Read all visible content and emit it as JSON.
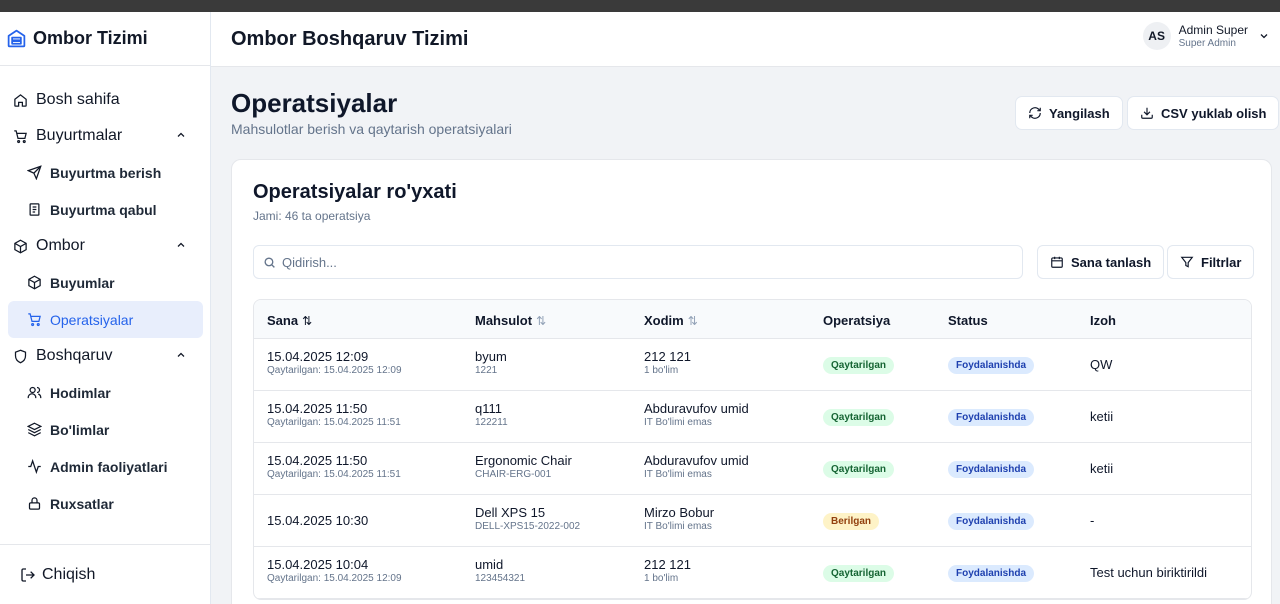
{
  "sidebar": {
    "brand": "Ombor Tizimi",
    "items": [
      {
        "label": "Bosh sahifa"
      },
      {
        "label": "Buyurtmalar"
      },
      {
        "label": "Buyurtma berish"
      },
      {
        "label": "Buyurtma qabul"
      },
      {
        "label": "Ombor"
      },
      {
        "label": "Buyumlar"
      },
      {
        "label": "Operatsiyalar"
      },
      {
        "label": "Boshqaruv"
      },
      {
        "label": "Hodimlar"
      },
      {
        "label": "Bo'limlar"
      },
      {
        "label": "Admin faoliyatlari"
      },
      {
        "label": "Ruxsatlar"
      }
    ],
    "logout": "Chiqish"
  },
  "header": {
    "title": "Ombor Boshqaruv Tizimi",
    "user": {
      "initials": "AS",
      "name": "Admin Super",
      "role": "Super Admin"
    }
  },
  "page": {
    "title": "Operatsiyalar",
    "subtitle": "Mahsulotlar berish va qaytarish operatsiyalari",
    "refresh_label": "Yangilash",
    "csv_label": "CSV yuklab olish"
  },
  "card": {
    "title": "Operatsiyalar ro'yxati",
    "subtitle": "Jami: 46 ta operatsiya",
    "search_placeholder": "Qidirish...",
    "date_button": "Sana tanlash",
    "filter_button": "Filtrlar"
  },
  "table": {
    "columns": [
      "Sana",
      "Mahsulot",
      "Xodim",
      "Operatsiya",
      "Status",
      "Izoh"
    ],
    "rows": [
      {
        "date": "15.04.2025 12:09",
        "date_sub": "Qaytarilgan: 15.04.2025 12:09",
        "product": "byum",
        "product_sub": "1221",
        "employee": "212 121",
        "employee_sub": "1 bo'lim",
        "operation": "Qaytarilgan",
        "status": "Foydalanishda",
        "note": "QW"
      },
      {
        "date": "15.04.2025 11:50",
        "date_sub": "Qaytarilgan: 15.04.2025 11:51",
        "product": "q111",
        "product_sub": "122211",
        "employee": "Abduravufov umid",
        "employee_sub": "IT Bo'limi emas",
        "operation": "Qaytarilgan",
        "status": "Foydalanishda",
        "note": "ketii"
      },
      {
        "date": "15.04.2025 11:50",
        "date_sub": "Qaytarilgan: 15.04.2025 11:51",
        "product": "Ergonomic Chair",
        "product_sub": "CHAIR-ERG-001",
        "employee": "Abduravufov umid",
        "employee_sub": "IT Bo'limi emas",
        "operation": "Qaytarilgan",
        "status": "Foydalanishda",
        "note": "ketii"
      },
      {
        "date": "15.04.2025 10:30",
        "date_sub": "",
        "product": "Dell XPS 15",
        "product_sub": "DELL-XPS15-2022-002",
        "employee": "Mirzo Bobur",
        "employee_sub": "IT Bo'limi emas",
        "operation": "Berilgan",
        "status": "Foydalanishda",
        "note": "-"
      },
      {
        "date": "15.04.2025 10:04",
        "date_sub": "Qaytarilgan: 15.04.2025 12:09",
        "product": "umid",
        "product_sub": "123454321",
        "employee": "212 121",
        "employee_sub": "1 bo'lim",
        "operation": "Qaytarilgan",
        "status": "Foydalanishda",
        "note": "Test uchun biriktirildi"
      }
    ]
  }
}
